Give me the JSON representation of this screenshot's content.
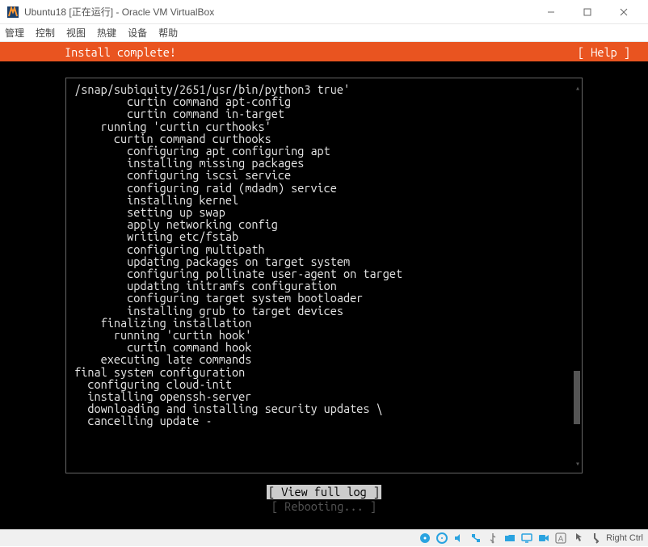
{
  "window": {
    "title": "Ubuntu18 [正在运行] - Oracle VM VirtualBox"
  },
  "menubar": {
    "items": [
      "管理",
      "控制",
      "视图",
      "热键",
      "设备",
      "帮助"
    ]
  },
  "installer": {
    "title": "Install complete!",
    "help": "[ Help ]"
  },
  "log": {
    "lines": [
      " /snap/subiquity/2651/usr/bin/python3 true'",
      "         curtin command apt-config",
      "         curtin command in-target",
      "     running 'curtin curthooks'",
      "       curtin command curthooks",
      "         configuring apt configuring apt",
      "         installing missing packages",
      "         configuring iscsi service",
      "         configuring raid (mdadm) service",
      "         installing kernel",
      "         setting up swap",
      "         apply networking config",
      "         writing etc/fstab",
      "         configuring multipath",
      "         updating packages on target system",
      "         configuring pollinate user-agent on target",
      "         updating initramfs configuration",
      "         configuring target system bootloader",
      "         installing grub to target devices",
      "     finalizing installation",
      "       running 'curtin hook'",
      "         curtin command hook",
      "     executing late commands",
      " final system configuration",
      "   configuring cloud-init",
      "   installing openssh-server",
      "   downloading and installing security updates \\",
      "   cancelling update -"
    ]
  },
  "actions": {
    "view_log": "[ View full log ]",
    "reboot": "[ Rebooting... ]"
  },
  "statusbar": {
    "host_key": "Right Ctrl"
  }
}
